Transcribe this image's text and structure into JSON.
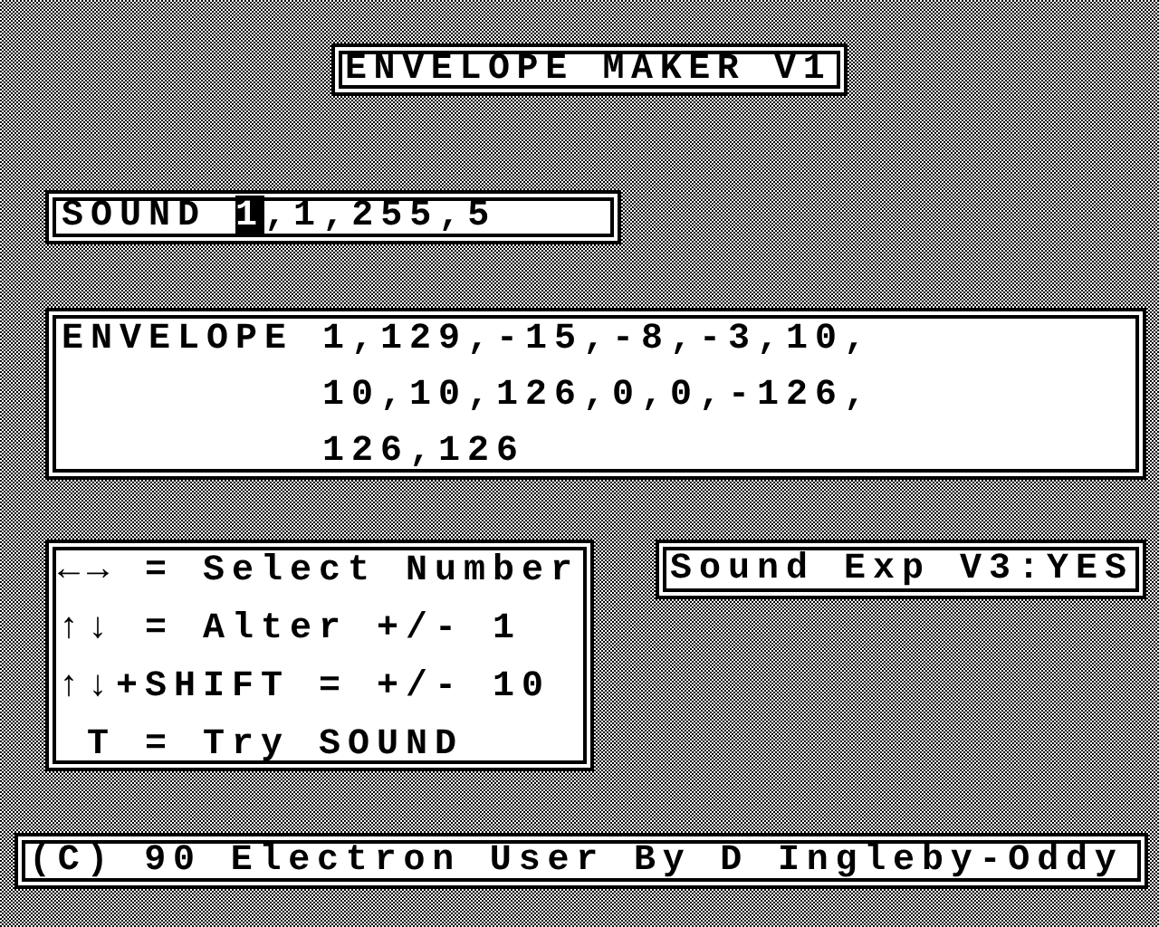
{
  "title": "ENVELOPE MAKER V1",
  "sound": {
    "keyword": "SOUND",
    "separator": ",",
    "params": [
      {
        "value": "1",
        "selected": true
      },
      {
        "value": "1",
        "selected": false
      },
      {
        "value": "255",
        "selected": false
      },
      {
        "value": "5",
        "selected": false
      }
    ]
  },
  "envelope": {
    "keyword": "ENVELOPE",
    "lines": [
      "1,129,-15,-8,-3,10,",
      "10,10,126,0,0,-126,",
      "126,126"
    ]
  },
  "keys": [
    "←→ = Select Number",
    "↑↓ = Alter +/- 1",
    "↑↓+SHIFT = +/- 10",
    " T = Try SOUND"
  ],
  "sound_exp": "Sound Exp V3:YES",
  "footer": "(C) 90 Electron User By D Ingleby-Oddy"
}
